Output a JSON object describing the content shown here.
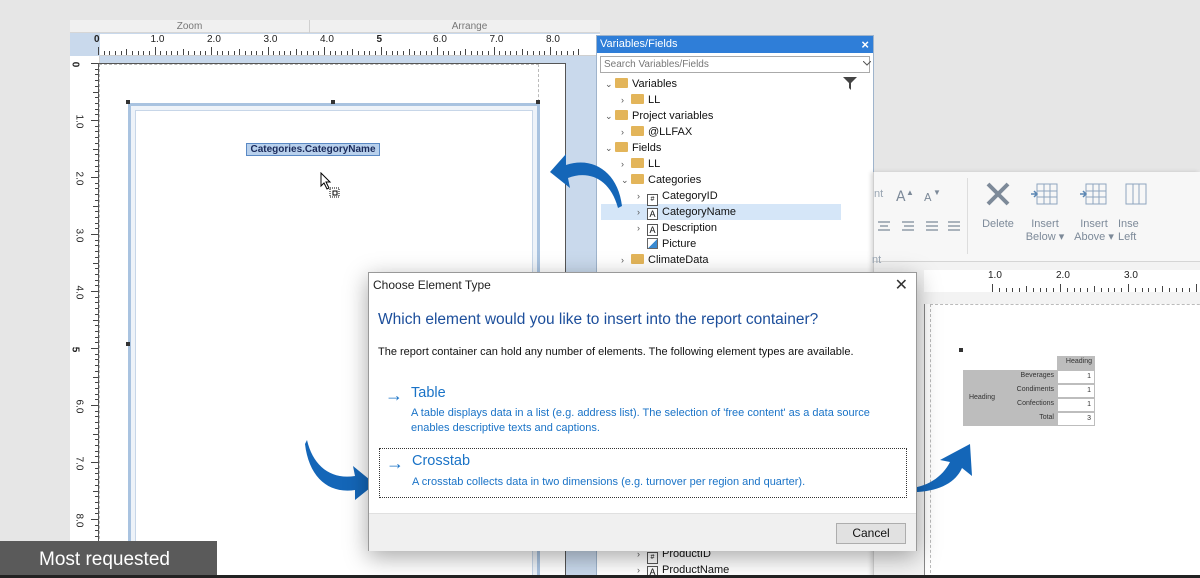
{
  "designer": {
    "tabs": [
      "Zoom",
      "Arrange"
    ],
    "ruler_h": [
      "0",
      "1.0",
      "2.0",
      "3.0",
      "4.0",
      "5",
      "6.0",
      "7.0",
      "8.0"
    ],
    "ruler_v": [
      "0",
      "1.0",
      "2.0",
      "3.0",
      "4.0",
      "5",
      "6.0",
      "7.0",
      "8.0"
    ],
    "field_label": "Categories.CategoryName"
  },
  "variables_panel": {
    "title": "Variables/Fields",
    "close": "×",
    "search_placeholder": "Search Variables/Fields",
    "tree": [
      {
        "label": "Variables",
        "icon": "variables-icon"
      },
      {
        "label": "LL",
        "icon": "folder-icon"
      },
      {
        "label": "Project variables",
        "icon": "project-icon"
      },
      {
        "label": "@LLFAX",
        "icon": "folder-icon"
      },
      {
        "label": "Fields",
        "icon": "fields-icon"
      },
      {
        "label": "LL",
        "icon": "folder-icon"
      },
      {
        "label": "Categories",
        "icon": "folder-icon"
      },
      {
        "label": "CategoryID",
        "icon": "field-icon"
      },
      {
        "label": "CategoryName",
        "icon": "text-field-icon"
      },
      {
        "label": "Description",
        "icon": "text-field-icon"
      },
      {
        "label": "Picture",
        "icon": "picture-icon"
      },
      {
        "label": "ClimateData",
        "icon": "folder-icon"
      }
    ],
    "tree_bottom": [
      {
        "label": "ProductID",
        "icon": "field-icon"
      },
      {
        "label": "ProductName",
        "icon": "text-field-icon"
      }
    ]
  },
  "ribbon": {
    "partial_left": "nt",
    "buttons": [
      {
        "label1": "Delete",
        "label2": ""
      },
      {
        "label1": "Insert",
        "label2": "Below ▾"
      },
      {
        "label1": "Insert",
        "label2": "Above ▾"
      },
      {
        "label1": "Inse",
        "label2": "Left"
      }
    ],
    "ruler": [
      "1.0",
      "2.0",
      "3.0"
    ]
  },
  "crosstab": {
    "heading_top": "Heading",
    "heading_left": "Heading",
    "rows": [
      {
        "label": "Beverages",
        "value": "1"
      },
      {
        "label": "Condiments",
        "value": "1"
      },
      {
        "label": "Confections",
        "value": "1"
      },
      {
        "label": "Total",
        "value": "3"
      }
    ]
  },
  "dialog": {
    "title": "Choose Element Type",
    "close": "✕",
    "heading": "Which element would you like to insert into the report container?",
    "description": "The report container can hold any number of elements. The following element types are available.",
    "options": [
      {
        "arrow": "→",
        "label": "Table",
        "text_line1": "A table displays data in a list (e.g. address list). The selection of 'free content' as a data source",
        "text_line2": "enables descriptive texts and captions."
      },
      {
        "arrow": "→",
        "label": "Crosstab",
        "text_line1": "A crosstab collects data in two dimensions (e.g. turnover per region and quarter).",
        "text_line2": ""
      }
    ],
    "cancel": "Cancel"
  },
  "badge": "Most requested",
  "colors": {
    "accent": "#1a73c7",
    "title_bar": "#2f7ed8",
    "callout_arrow": "#1466b8"
  }
}
